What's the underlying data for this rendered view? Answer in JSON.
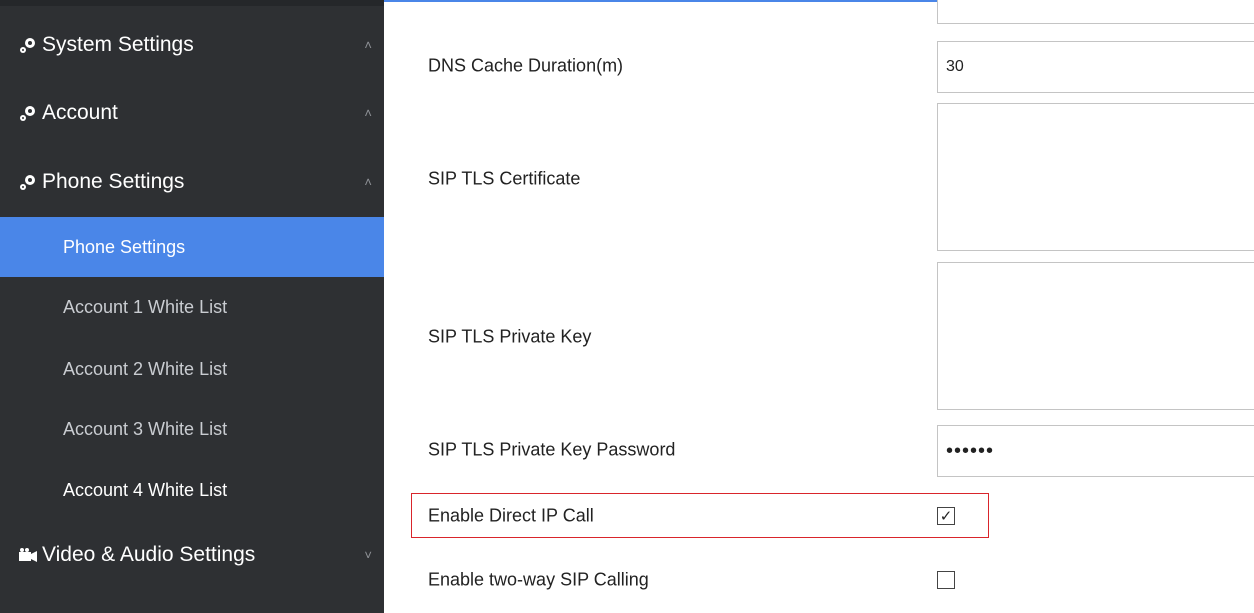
{
  "sidebar": {
    "groups": [
      {
        "label": "System Settings",
        "icon": "gears-icon",
        "expanded": true
      },
      {
        "label": "Account",
        "icon": "gears-icon",
        "expanded": true
      },
      {
        "label": "Phone Settings",
        "icon": "gears-icon",
        "expanded": true
      },
      {
        "label": "Video & Audio Settings",
        "icon": "camera-icon",
        "expanded": false
      }
    ],
    "items": [
      {
        "label": "Phone Settings",
        "active": true
      },
      {
        "label": "Account 1 White List"
      },
      {
        "label": "Account 2 White List"
      },
      {
        "label": "Account 3 White List"
      },
      {
        "label": "Account 4 White List"
      }
    ],
    "chevron_up": "˄",
    "chevron_down": "˅"
  },
  "form": {
    "dns_cache": {
      "label": "DNS Cache Duration(m)",
      "value": "30"
    },
    "tls_cert": {
      "label": "SIP TLS Certificate",
      "value": ""
    },
    "tls_key": {
      "label": "SIP TLS Private Key",
      "value": ""
    },
    "tls_key_password": {
      "label": "SIP TLS Private Key Password",
      "value": "••••••"
    },
    "direct_ip_call": {
      "label": "Enable Direct IP Call",
      "checked": true,
      "mark": "✓"
    },
    "two_way_sip": {
      "label": "Enable two-way SIP Calling",
      "checked": false,
      "mark": ""
    }
  },
  "colors": {
    "sidebar_bg": "#2e3033",
    "active_bg": "#4a86e8",
    "highlight_border": "#d9252b"
  }
}
